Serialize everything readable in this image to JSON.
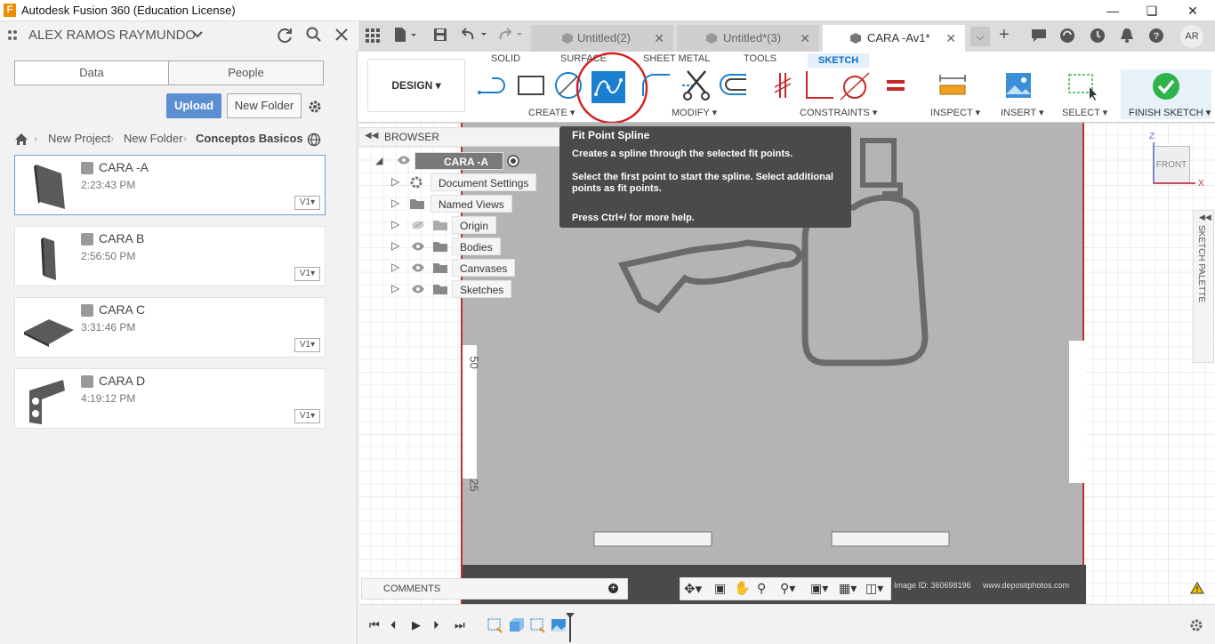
{
  "window": {
    "title": "Autodesk Fusion 360 (Education License)",
    "app_icon": "F"
  },
  "data_panel": {
    "user": "ALEX RAMOS RAYMUNDO",
    "tabs": [
      "Data",
      "People"
    ],
    "upload_label": "Upload",
    "new_folder_label": "New Folder",
    "breadcrumb": [
      "New Project",
      "New Folder",
      "Conceptos Basicos"
    ],
    "items": [
      {
        "name": "CARA -A",
        "time": "2:23:43 PM",
        "version": "V1"
      },
      {
        "name": "CARA B",
        "time": "2:56:50 PM",
        "version": "V1"
      },
      {
        "name": "CARA C",
        "time": "3:31:46 PM",
        "version": "V1"
      },
      {
        "name": "CARA D",
        "time": "4:19:12 PM",
        "version": "V1"
      }
    ]
  },
  "doc_tabs": [
    {
      "label": "Untitled(2)"
    },
    {
      "label": "Untitled*(3)"
    },
    {
      "label": "CARA -Av1*"
    }
  ],
  "user_initials": "AR",
  "ribbon": {
    "workspace": "DESIGN",
    "tabs": [
      "SOLID",
      "SURFACE",
      "SHEET METAL",
      "TOOLS",
      "SKETCH"
    ],
    "groups": {
      "create": "CREATE",
      "modify": "MODIFY",
      "constraints": "CONSTRAINTS",
      "inspect": "INSPECT",
      "insert": "INSERT",
      "select": "SELECT",
      "finish": "FINISH SKETCH"
    }
  },
  "browser": {
    "title": "BROWSER",
    "root": "CARA -A v1",
    "nodes": [
      "Document Settings",
      "Named Views",
      "Origin",
      "Bodies",
      "Canvases",
      "Sketches"
    ]
  },
  "tooltip": {
    "title": "Fit Point Spline",
    "line1": "Creates a spline through the selected fit points.",
    "line2": "Select the first point to start the spline. Select additional points as fit points.",
    "line3": "Press Ctrl+/ for more help."
  },
  "canvas": {
    "dim1": "50",
    "dim2": "25",
    "image_id": "Image ID: 360698196",
    "site": "www.depositphotos.com"
  },
  "viewcube": {
    "face": "FRONT",
    "axis_z": "Z",
    "axis_x": "X"
  },
  "palette": "SKETCH PALETTE",
  "comments": "COMMENTS",
  "colors": {
    "accent": "#0b72c4",
    "upload": "#5b8fd1",
    "finish_check": "#2eb24a",
    "highlight_ring": "#d42020"
  }
}
